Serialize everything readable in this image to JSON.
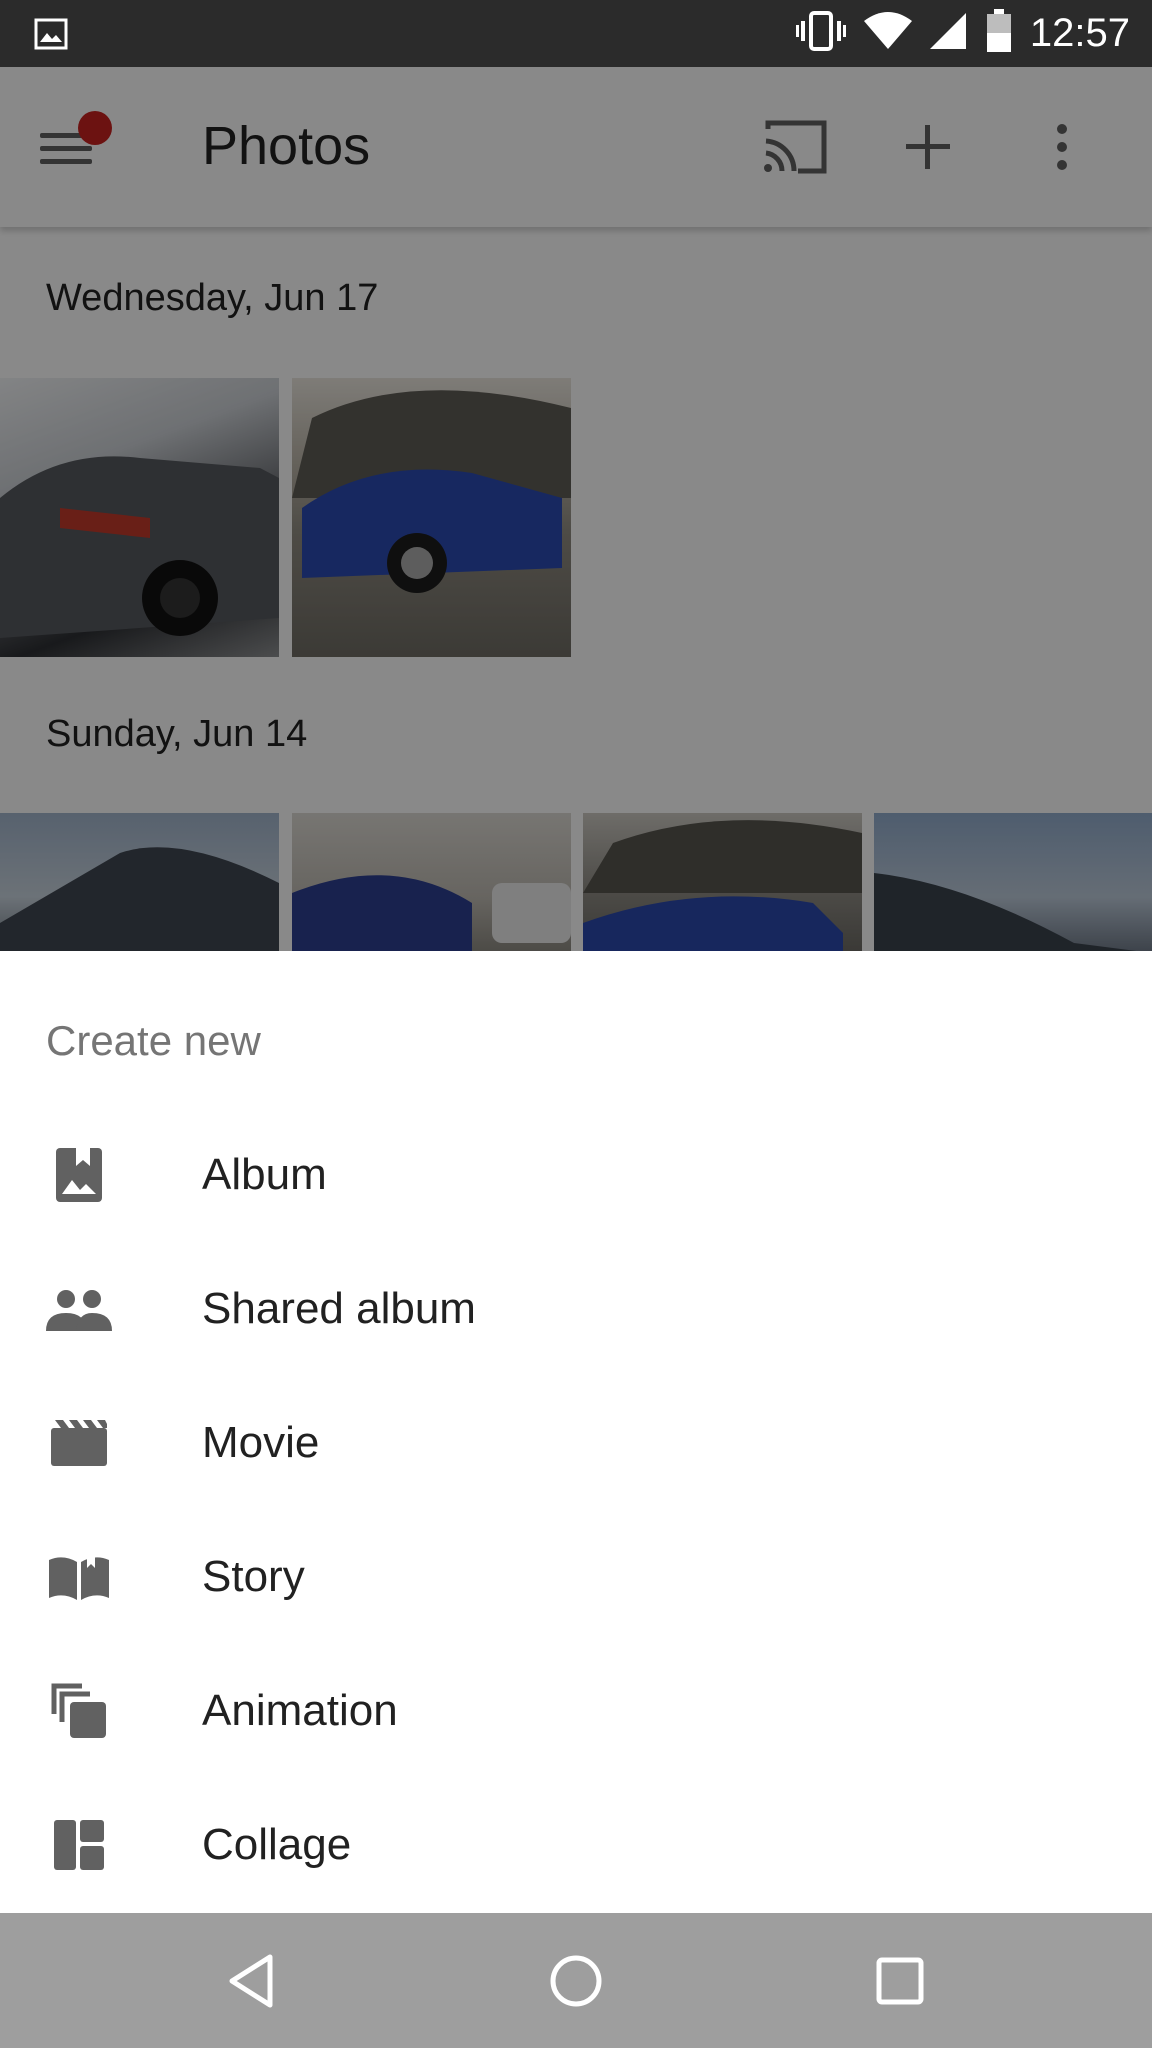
{
  "status_bar": {
    "time": "12:57",
    "icons": [
      "image-notification-icon",
      "vibrate-icon",
      "wifi-icon",
      "signal-icon",
      "battery-icon"
    ]
  },
  "toolbar": {
    "title": "Photos",
    "icons": [
      "menu-icon",
      "cast-icon",
      "add-icon",
      "more-vert-icon"
    ],
    "notification_dot_color": "#c5221f"
  },
  "photo_groups": [
    {
      "date": "Wednesday, Jun 17",
      "photo_count_visible": 2
    },
    {
      "date": "Sunday, Jun 14",
      "photo_count_visible": 4
    }
  ],
  "sheet": {
    "heading": "Create new",
    "items": [
      {
        "label": "Album",
        "icon": "album-icon"
      },
      {
        "label": "Shared album",
        "icon": "people-icon"
      },
      {
        "label": "Movie",
        "icon": "movie-icon"
      },
      {
        "label": "Story",
        "icon": "book-icon"
      },
      {
        "label": "Animation",
        "icon": "animation-icon"
      },
      {
        "label": "Collage",
        "icon": "collage-icon"
      }
    ]
  },
  "nav_bar": {
    "buttons": [
      "back-icon",
      "home-icon",
      "recents-icon"
    ]
  }
}
